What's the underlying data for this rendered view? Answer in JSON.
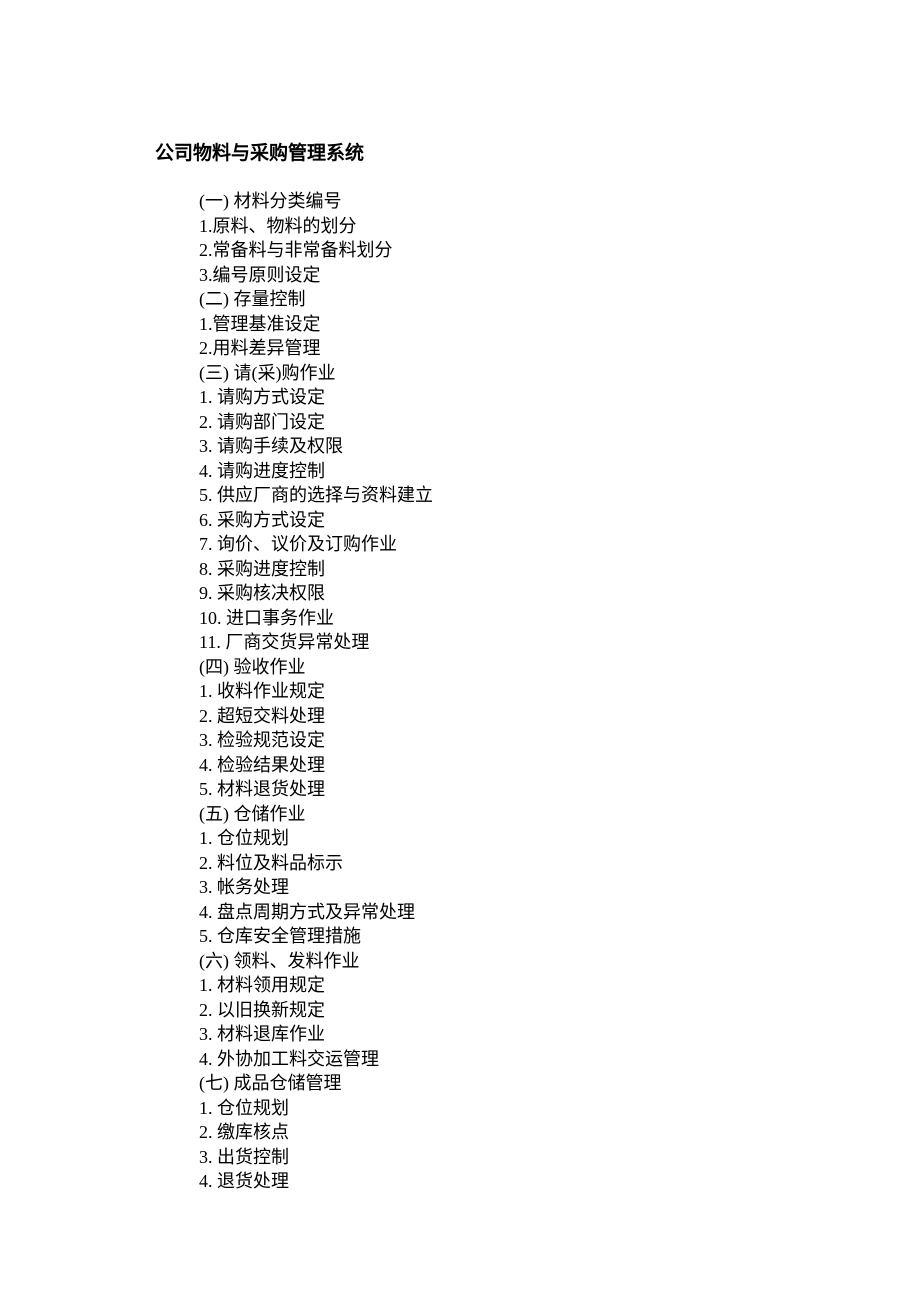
{
  "title": "公司物料与采购管理系统",
  "outline": [
    "(一) 材料分类编号",
    "1.原料、物料的划分",
    "2.常备料与非常备料划分",
    "3.编号原则设定",
    "(二) 存量控制",
    "1.管理基准设定",
    "2.用料差异管理",
    "(三) 请(采)购作业",
    "1. 请购方式设定",
    "2. 请购部门设定",
    "3. 请购手续及权限",
    "4. 请购进度控制",
    "5. 供应厂商的选择与资料建立",
    "6. 采购方式设定",
    "7. 询价、议价及订购作业",
    "8. 采购进度控制",
    "9. 采购核决权限",
    "10. 进口事务作业",
    "11. 厂商交货异常处理",
    "(四) 验收作业",
    "1. 收料作业规定",
    "2. 超短交料处理",
    "3. 检验规范设定",
    "4. 检验结果处理",
    "5. 材料退货处理",
    "(五) 仓储作业",
    "1. 仓位规划",
    "2. 料位及料品标示",
    "3. 帐务处理",
    "4. 盘点周期方式及异常处理",
    "5. 仓库安全管理措施",
    "(六) 领料、发料作业",
    "1. 材料领用规定",
    "2. 以旧换新规定",
    "3. 材料退库作业",
    "4. 外协加工料交运管理",
    "(七) 成品仓储管理",
    "1. 仓位规划",
    "2. 缴库核点",
    "3. 出货控制",
    "4. 退货处理"
  ]
}
